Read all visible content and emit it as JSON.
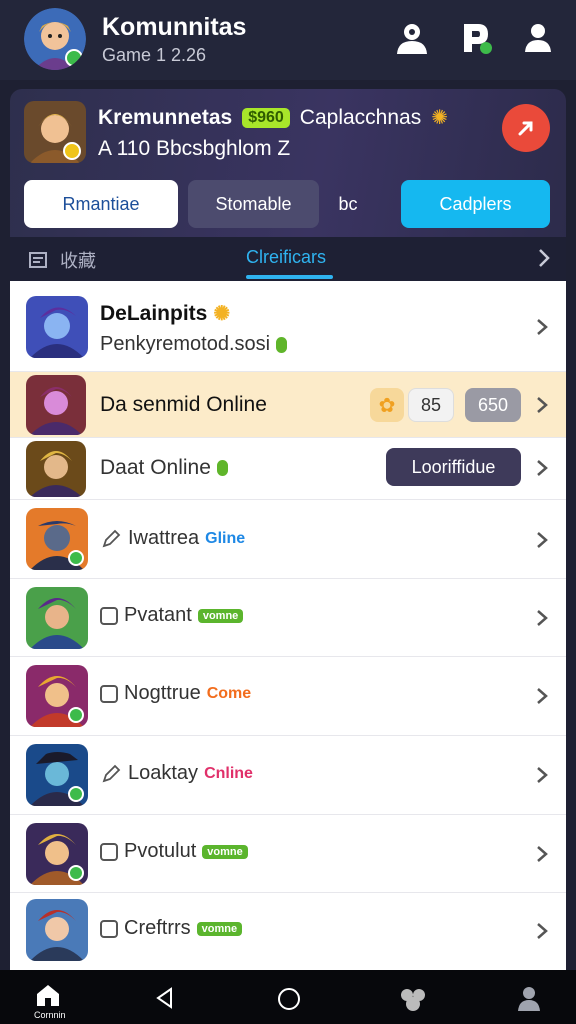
{
  "header": {
    "title": "Komunnitas",
    "subtitle": "Game 1 2.26",
    "icons": [
      "user-icon",
      "p-icon",
      "profile-icon"
    ]
  },
  "card": {
    "name": "Kremunnetas",
    "score": "$960",
    "tag": "Caplacchnas",
    "desc": "A 110 Bbcsbghlom Z",
    "fab_icon": "arrow-icon",
    "buttons": {
      "romantic": "Rmantiae",
      "stomable": "Stomable",
      "bc": "bc",
      "cadplers": "Cadplers"
    },
    "tabs": {
      "active": "Clreificars",
      "icon_label": "收藏"
    }
  },
  "list": [
    {
      "title": "DeLainpits",
      "subtitle": "Penkyremotod.sosi"
    },
    {
      "title": "Da senmid Online",
      "chip_value": "85",
      "chip_label": "650"
    },
    {
      "title": "Daat Online",
      "button": "Looriffidue"
    },
    {
      "title": "Iwattrea",
      "status": "Gline",
      "status_color": "#1e88e5"
    },
    {
      "title": "Pvatant",
      "status": "vomne",
      "status_color": "#5bb52d"
    },
    {
      "title": "Nogttrue",
      "status": "Come",
      "status_color": "#f26d1d"
    },
    {
      "title": "Loaktay",
      "status": "Cnline",
      "status_color": "#e0306a"
    },
    {
      "title": "Pvotulut",
      "status": "vomne",
      "status_color": "#5bb52d"
    },
    {
      "title": "Creftrrs",
      "status": "vomne",
      "status_color": "#5bb52d"
    }
  ],
  "nav": {
    "home_label": "Cornnin",
    "items": [
      "home-icon",
      "back-icon",
      "home-circle-icon",
      "community-icon",
      "profile-icon"
    ]
  }
}
